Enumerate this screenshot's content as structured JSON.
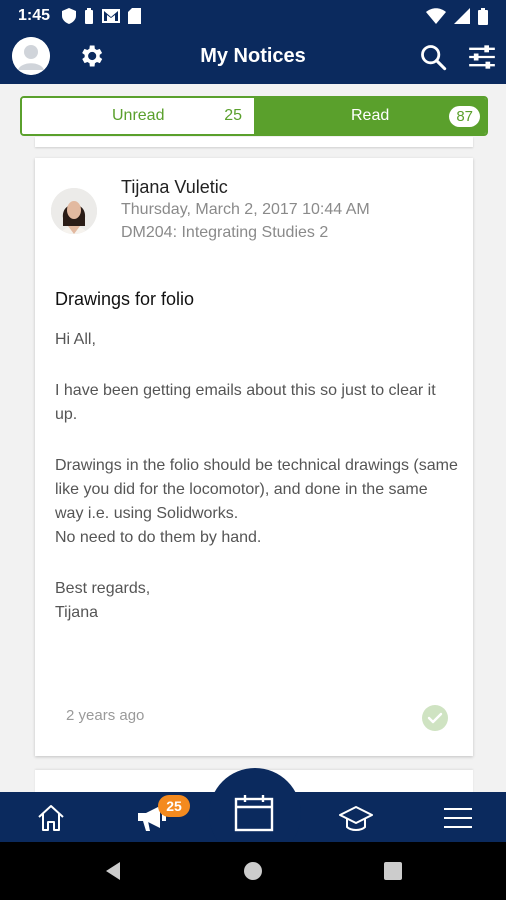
{
  "status_bar": {
    "time": "1:45",
    "icons_left": [
      "shield-icon",
      "battery-saver-icon",
      "gmail-icon",
      "sd-card-icon"
    ],
    "icons_right": [
      "wifi-icon",
      "signal-icon",
      "battery-icon"
    ]
  },
  "header": {
    "title": "My Notices",
    "icons": [
      "profile-avatar",
      "gear-icon",
      "search-icon",
      "filter-sliders-icon"
    ]
  },
  "tabs": {
    "unread": {
      "label": "Unread",
      "count": "25"
    },
    "read": {
      "label": "Read",
      "count": "87",
      "active": true
    }
  },
  "notice": {
    "author": "Tijana Vuletic",
    "date": "Thursday, March 2, 2017 10:44 AM",
    "course": "DM204: Integrating Studies 2",
    "title": "Drawings for folio",
    "body": {
      "greeting": "Hi All,",
      "p1": "I have been getting emails about this so just to clear it up.",
      "p2": "Drawings in the folio should be technical drawings (same like you did for the locomotor), and done in the same way i.e. using Solidworks.",
      "p3": "No need to do them by hand.",
      "signoff": "Best regards,",
      "signature": "Tijana"
    },
    "age": "2 years ago",
    "status_icon": "check-circle-icon"
  },
  "bottom_nav": {
    "items": [
      "home-icon",
      "megaphone-icon",
      "calendar-icon",
      "graduation-cap-icon",
      "menu-icon"
    ],
    "badge": "25"
  },
  "colors": {
    "primary": "#0b2a5e",
    "accent_green": "#5aa02c",
    "badge_orange": "#f48a1f"
  }
}
